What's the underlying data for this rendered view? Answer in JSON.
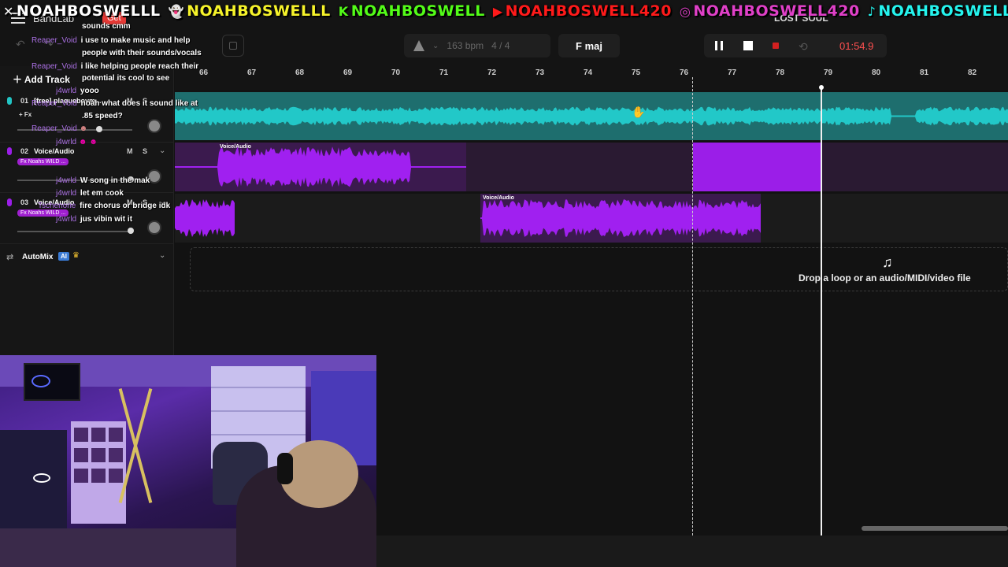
{
  "social_banner": [
    {
      "platform": "x",
      "icon": "x-logo-icon",
      "handle": "NOAHBOSWELLL"
    },
    {
      "platform": "snapchat",
      "icon": "snapchat-icon",
      "handle": "NOAHBOSWELLL"
    },
    {
      "platform": "kick",
      "icon": "kick-icon",
      "handle": "NOAHBOSWELL"
    },
    {
      "platform": "youtube",
      "icon": "youtube-icon",
      "handle": "NOAHBOSWELL420"
    },
    {
      "platform": "instagram",
      "icon": "instagram-icon",
      "handle": "NOAHBOSWELL420"
    },
    {
      "platform": "tiktok",
      "icon": "tiktok-icon",
      "handle": "NOAHBOSWELL420"
    }
  ],
  "header": {
    "logo": "BandLab",
    "get_label": "Get",
    "project_title": "LOST SOUL",
    "tempo": "163 bpm",
    "time_signature": "4 / 4",
    "key": "F maj",
    "time": "01:54.9"
  },
  "left_panel": {
    "add_track": "Add Track",
    "tracks": [
      {
        "num": "01",
        "name": "[free] plaqueboym...",
        "fx": "+ Fx",
        "mute": "M",
        "solo": "S"
      },
      {
        "num": "02",
        "name": "Voice/Audio",
        "fx": "Fx Noahs WILD ...",
        "mute": "M",
        "solo": "S"
      },
      {
        "num": "03",
        "name": "Voice/Audio",
        "fx": "Fx Noahs WILD ...",
        "mute": "M",
        "solo": "S"
      }
    ],
    "automix": {
      "label": "AutoMix",
      "badge": "AI"
    }
  },
  "ruler": {
    "ticks": [
      "66",
      "67",
      "68",
      "69",
      "70",
      "71",
      "72",
      "73",
      "74",
      "75",
      "76",
      "77",
      "78",
      "79",
      "80",
      "81",
      "82"
    ]
  },
  "clips": {
    "track2_label": "Voice/Audio",
    "track3_label": "Voice/Audio"
  },
  "dropzone": {
    "text": "Drop a loop or an audio/MIDI/video file"
  },
  "chat": [
    {
      "user": "",
      "msg": "sounds cmm"
    },
    {
      "user": "Reaper_Void",
      "msg": "i use to make music and help"
    },
    {
      "user": "",
      "msg": "people with their sounds/vocals"
    },
    {
      "user": "Reaper_Void",
      "msg": "i like helping people reach their"
    },
    {
      "user": "",
      "msg": "potential its cool to see"
    },
    {
      "user": "j4wrld",
      "msg": "yooo"
    },
    {
      "user": "Reaper_Void",
      "msg": "noah what does it sound like at"
    },
    {
      "user": "",
      "msg": ".85 speed?"
    },
    {
      "user": "Reaper_Void",
      "msg": ""
    },
    {
      "user": "j4wrld",
      "msg": ""
    },
    {
      "user": "j4wrld",
      "msg": "W song in the mak"
    },
    {
      "user": "j4wrld",
      "msg": "let em cook"
    },
    {
      "user": "Tschenone",
      "msg": "fire chorus or bridge idk"
    },
    {
      "user": "j4wrld",
      "msg": "jus vibin wit it"
    }
  ],
  "colors": {
    "track1": "#22c4c4",
    "track2": "#9b1ee8",
    "track3": "#9b1ee8",
    "time_display": "#ff5050"
  }
}
